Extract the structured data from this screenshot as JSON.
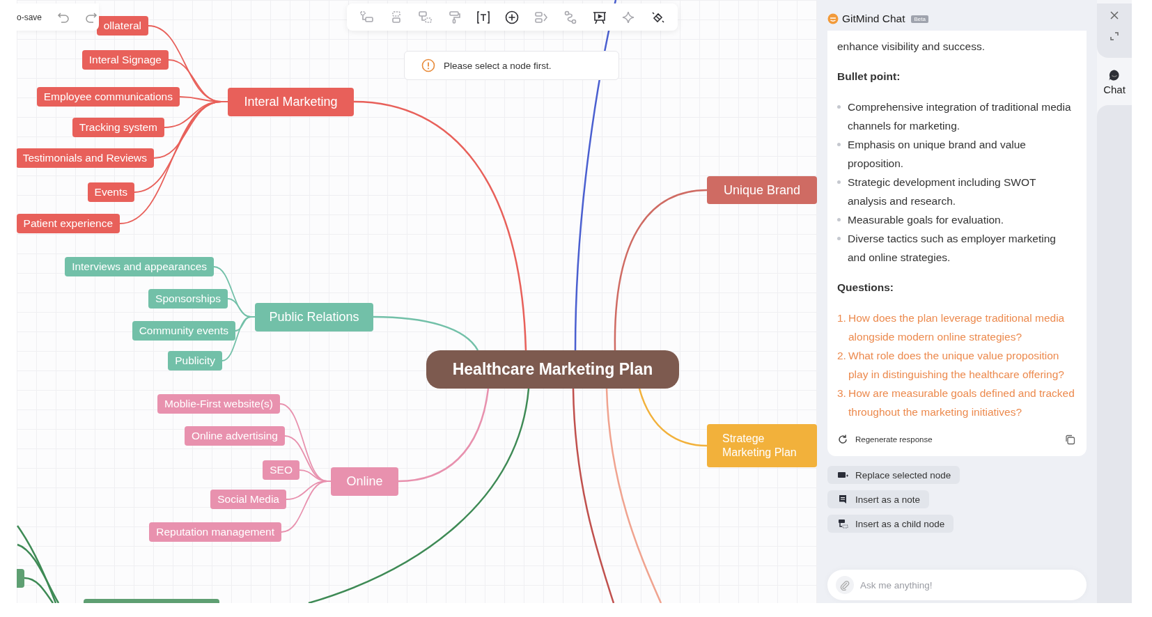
{
  "top_bar": {
    "autosave_label": "o-save"
  },
  "toolbar": {
    "tools": [
      {
        "disabled": true
      },
      {
        "disabled": true
      },
      {
        "disabled": true
      },
      {
        "disabled": true
      },
      {
        "disabled": false
      },
      {
        "disabled": false
      },
      {
        "disabled": true
      },
      {
        "disabled": true
      },
      {
        "disabled": false
      },
      {
        "disabled": true
      },
      {
        "disabled": false
      }
    ]
  },
  "toast": {
    "message": "Please select a node first."
  },
  "mind_map": {
    "root": {
      "label": "Healthcare Marketing Plan"
    },
    "branches": [
      {
        "label": "Interal Marketing",
        "color": "#e8605a",
        "children": [
          {
            "label": "ollateral"
          },
          {
            "label": "Interal Signage"
          },
          {
            "label": "Employee communications"
          },
          {
            "label": "Tracking system"
          },
          {
            "label": "Testimonials and Reviews"
          },
          {
            "label": "Events"
          },
          {
            "label": "Patient experience"
          }
        ]
      },
      {
        "label": "Public Relations",
        "color": "#72c0a8",
        "children": [
          {
            "label": "Interviews and appearances"
          },
          {
            "label": "Sponsorships"
          },
          {
            "label": "Community events"
          },
          {
            "label": "Publicity"
          }
        ]
      },
      {
        "label": "Online",
        "color": "#e891ae",
        "children": [
          {
            "label": "Moblie-First website(s)"
          },
          {
            "label": "Online advertising"
          },
          {
            "label": "SEO"
          },
          {
            "label": "Social Media"
          },
          {
            "label": "Reputation management"
          }
        ]
      },
      {
        "label": "Unique Brand",
        "color": "#cf6b63"
      },
      {
        "label": "Stratege Marketing Plan",
        "color": "#f2b13b"
      }
    ]
  },
  "chat": {
    "title": "GitMind Chat",
    "badge": "Beta",
    "intro": "enhance visibility and success.",
    "bullet_heading": "Bullet point:",
    "bullets": [
      "Comprehensive integration of traditional media channels for marketing.",
      "Emphasis on unique brand and value proposition.",
      "Strategic development including SWOT analysis and research.",
      "Measurable goals for evaluation.",
      "Diverse tactics such as employer marketing and online strategies."
    ],
    "questions_heading": "Questions:",
    "questions": [
      {
        "number": "1.",
        "text": "How does the plan leverage traditional media alongside modern online strategies?"
      },
      {
        "number": "2.",
        "text": "What role does the unique value proposition play in distinguishing the healthcare offering?"
      },
      {
        "number": "3.",
        "text": "How are measurable goals defined and tracked throughout the marketing initiatives?"
      }
    ],
    "regenerate": "Regenerate response",
    "actions": [
      "Replace selected node",
      "Insert as a note",
      "Insert as a child node"
    ],
    "input": {
      "placeholder": "Ask me anything!"
    }
  },
  "rail": {
    "chat_label": "Chat"
  }
}
